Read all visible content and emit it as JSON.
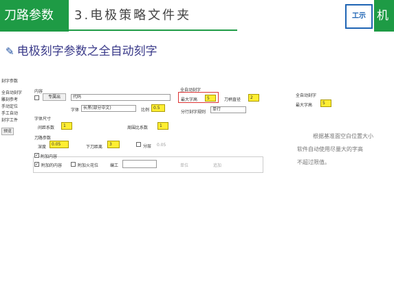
{
  "header": {
    "section_tab": "刀路参数",
    "chapter_title": "3.电极策略文件夹",
    "logo_text": "工示",
    "logo_right": "机"
  },
  "subtitle": "电极刻字参数之全自动刻字",
  "sidebar": {
    "title": "刻字参数",
    "items": [
      "全自动刻字",
      "雕刻参考",
      "手动定位",
      "手工自动",
      "刻字工件",
      "预览"
    ]
  },
  "content": {
    "label": "内容",
    "special_btn": "专属出",
    "content_value": "代码",
    "font_label": "字体",
    "font_value": "长黑(部分中文)",
    "ratio_label": "比例",
    "ratio_value": "0.5"
  },
  "char_size": {
    "group_label": "字体尺寸",
    "spacing_label": "间距系数",
    "spacing_value": "1",
    "border_label": "周围比系数",
    "border_value": "1"
  },
  "tool_params": {
    "group_label": "刀路参数",
    "depth_label": "深度",
    "depth_value": "0.05",
    "down_label": "下刀距离",
    "down_value": "3",
    "layer_label": "分层",
    "layer_value": "0.05"
  },
  "attach": {
    "group_label": "附加内容",
    "attach1": "附加的内容",
    "attach2": "附加火花位",
    "num_label": "编工",
    "btn1": "单位",
    "btn2": "追加"
  },
  "auto_engrave": {
    "group_label": "全自动刻字",
    "max_size_label": "最大字高",
    "max_size_value": "5",
    "tool_gap_label": "刀柄直径",
    "tool_gap_value": "2",
    "order_label": "分行刻字规则",
    "order_value": "单行"
  },
  "callout": {
    "group_label": "全自动刻字",
    "max_size_label": "最大字高",
    "max_size_value": "5"
  },
  "notes": [
    "根据基准面空白位置大小",
    "软件自动使用尽量大的字高",
    "不超过限值。"
  ]
}
